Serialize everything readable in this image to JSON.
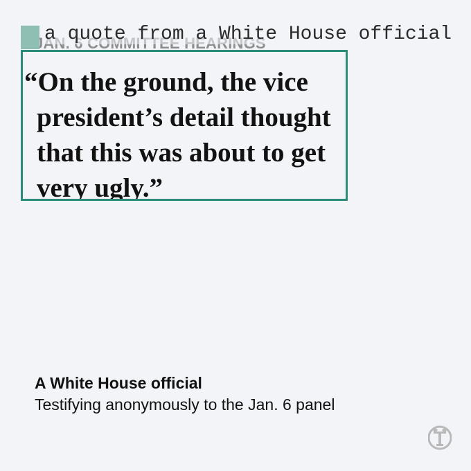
{
  "kicker": "JAN. 6 COMMITTEE HEARINGS",
  "annotation": {
    "label": "a quote from a White House official",
    "color": "#2a8b79",
    "chip_color": "#8fbfb3"
  },
  "quote": {
    "text": "“On the ground, the vice president’s detail thought that this was about to get very ugly.”"
  },
  "attribution": {
    "name": "A White House official",
    "description": "Testifying anonymously to the Jan. 6 panel"
  },
  "logo": {
    "icon": "nyt-t-logo-icon",
    "color": "#b9b9b9"
  },
  "colors": {
    "background": "#f3f4f7",
    "text": "#121212",
    "kicker": "#8d8d8d"
  }
}
